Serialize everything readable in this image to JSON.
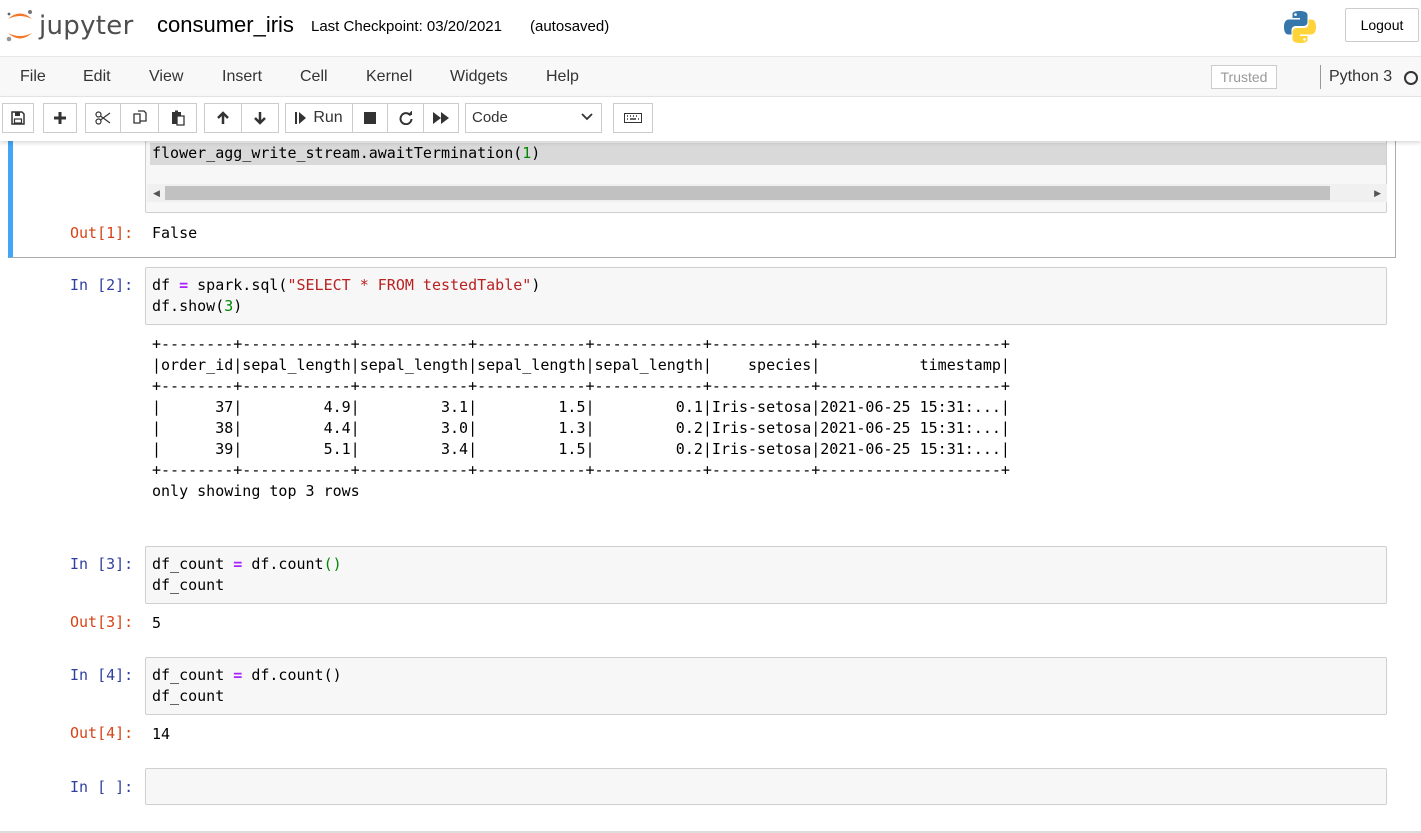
{
  "header": {
    "logo_text": "jupyter",
    "notebook_name": "consumer_iris",
    "checkpoint": "Last Checkpoint: 03/20/2021",
    "autosave": "(autosaved)",
    "logout_label": "Logout"
  },
  "menubar": {
    "items": [
      "File",
      "Edit",
      "View",
      "Insert",
      "Cell",
      "Kernel",
      "Widgets",
      "Help"
    ],
    "trusted_label": "Trusted",
    "kernel_name": "Python 3"
  },
  "toolbar": {
    "run_label": "Run",
    "cell_type": "Code",
    "icons": [
      "save-icon",
      "plus-icon",
      "scissors-icon",
      "copy-icon",
      "paste-icon",
      "arrow-up-icon",
      "arrow-down-icon",
      "run-icon",
      "stop-icon",
      "restart-icon",
      "fast-forward-icon",
      "chevron-down-icon",
      "keyboard-icon"
    ]
  },
  "cells": {
    "c1": {
      "code_line": "flower_agg_write_stream.awaitTermination(1)",
      "code_name": "flower_agg_write_stream.awaitTermination(",
      "code_num": "1",
      "code_close": ")",
      "out_prompt": "Out[1]:",
      "output": "False"
    },
    "c2": {
      "in_prompt": "In [2]:",
      "l1_a": "df ",
      "l1_op": "=",
      "l1_b": " spark.sql(",
      "l1_str": "\"SELECT * FROM testedTable\"",
      "l1_c": ")",
      "l2_a": "df.show(",
      "l2_num": "3",
      "l2_c": ")",
      "output_lines": [
        "+--------+------------+------------+------------+------------+-----------+--------------------+",
        "|order_id|sepal_length|sepal_length|sepal_length|sepal_length|    species|           timestamp|",
        "+--------+------------+------------+------------+------------+-----------+--------------------+",
        "|      37|         4.9|         3.1|         1.5|         0.1|Iris-setosa|2021-06-25 15:31:...|",
        "|      38|         4.4|         3.0|         1.3|         0.2|Iris-setosa|2021-06-25 15:31:...|",
        "|      39|         5.1|         3.4|         1.5|         0.2|Iris-setosa|2021-06-25 15:31:...|",
        "+--------+------------+------------+------------+------------+-----------+--------------------+",
        "only showing top 3 rows"
      ]
    },
    "c3": {
      "in_prompt": "In [3]:",
      "l1_a": "df_count ",
      "l1_op": "=",
      "l1_b": " df.count",
      "l1_paren": "()",
      "l2": "df_count",
      "out_prompt": "Out[3]:",
      "output": "5"
    },
    "c4": {
      "in_prompt": "In [4]:",
      "l1_a": "df_count ",
      "l1_op": "=",
      "l1_b": " df.count()",
      "l2": "df_count",
      "out_prompt": "Out[4]:",
      "output": "14"
    },
    "c5": {
      "in_prompt": "In [ ]:"
    }
  }
}
